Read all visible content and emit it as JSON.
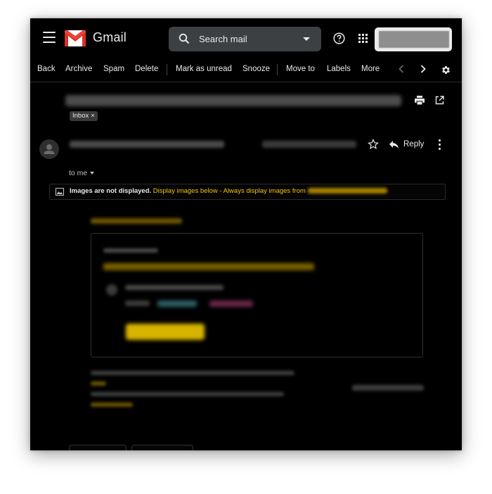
{
  "app": {
    "brand": "Gmail"
  },
  "search": {
    "placeholder": "Search mail"
  },
  "toolbar": {
    "back": "Back",
    "archive": "Archive",
    "spam": "Spam",
    "delete": "Delete",
    "mark_unread": "Mark as unread",
    "snooze": "Snooze",
    "move_to": "Move to",
    "labels": "Labels",
    "more": "More"
  },
  "message": {
    "label_chip": "Inbox",
    "recipient": "to me",
    "reply_label": "Reply"
  },
  "images_banner": {
    "notice": "Images are not displayed.",
    "display_below": "Display images below",
    "separator": "-",
    "always_display": "Always display images from"
  },
  "icons": {
    "menu": "menu-icon",
    "logo": "gmail-logo-icon",
    "search": "search-icon",
    "help": "help-icon",
    "apps": "apps-grid-icon",
    "settings": "gear-icon",
    "print": "print-icon",
    "popout": "open-in-new-window-icon",
    "star": "star-icon",
    "reply": "reply-icon",
    "more": "more-vert-icon",
    "image": "image-icon"
  },
  "colors": {
    "background": "#000000",
    "search_bg": "#3c4043",
    "link": "#f4c20d",
    "text": "#e8eaed"
  }
}
